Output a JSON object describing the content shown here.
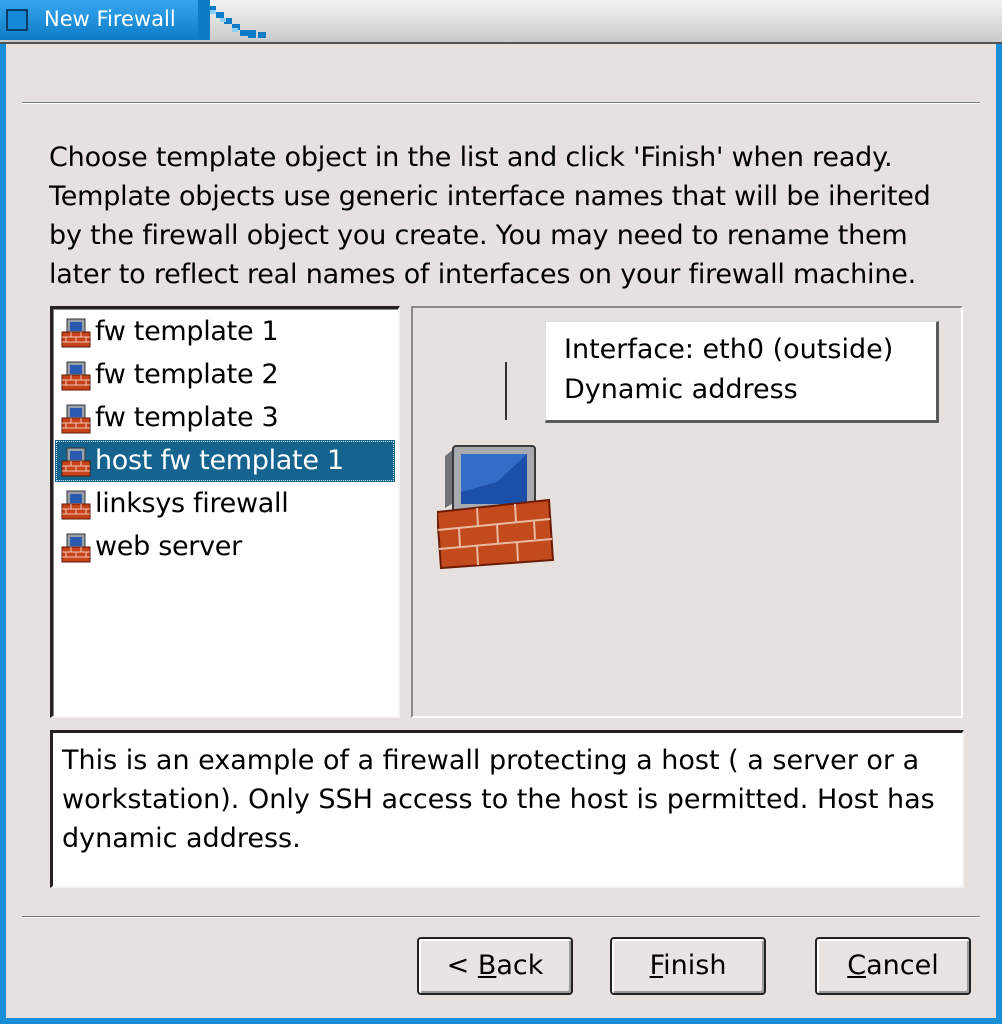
{
  "window": {
    "title": "New Firewall"
  },
  "instructions": [
    "Choose template object in the list and click 'Finish' when ready.",
    "Template objects use generic interface names that will be iherited",
    "by the firewall object you create. You may need to rename them",
    "later to reflect real names of interfaces on your firewall machine."
  ],
  "templates": [
    {
      "label": "fw template 1",
      "icon": "firewall-icon",
      "selected": false
    },
    {
      "label": "fw template 2",
      "icon": "firewall-icon",
      "selected": false
    },
    {
      "label": "fw template 3",
      "icon": "firewall-icon",
      "selected": false
    },
    {
      "label": "host fw template 1",
      "icon": "firewall-icon",
      "selected": true
    },
    {
      "label": "linksys firewall",
      "icon": "firewall-icon",
      "selected": false
    },
    {
      "label": "web server",
      "icon": "firewall-icon",
      "selected": false
    }
  ],
  "preview": {
    "interface_line1": "Interface: eth0 (outside)",
    "interface_line2": "Dynamic address",
    "icon": "host-firewall-icon"
  },
  "description": "This is an example of a firewall protecting a host ( a server or a workstation). Only SSH access to the host is permitted. Host has dynamic address.",
  "buttons": {
    "back": {
      "prefix": "< ",
      "mnemonic": "B",
      "rest": "ack"
    },
    "finish": {
      "prefix": "",
      "mnemonic": "F",
      "rest": "inish"
    },
    "cancel": {
      "prefix": "",
      "mnemonic": "C",
      "rest": "ancel"
    }
  },
  "colors": {
    "accent": "#1a8fd8",
    "selection": "#15638f",
    "dialog_bg": "#e6e0de"
  }
}
